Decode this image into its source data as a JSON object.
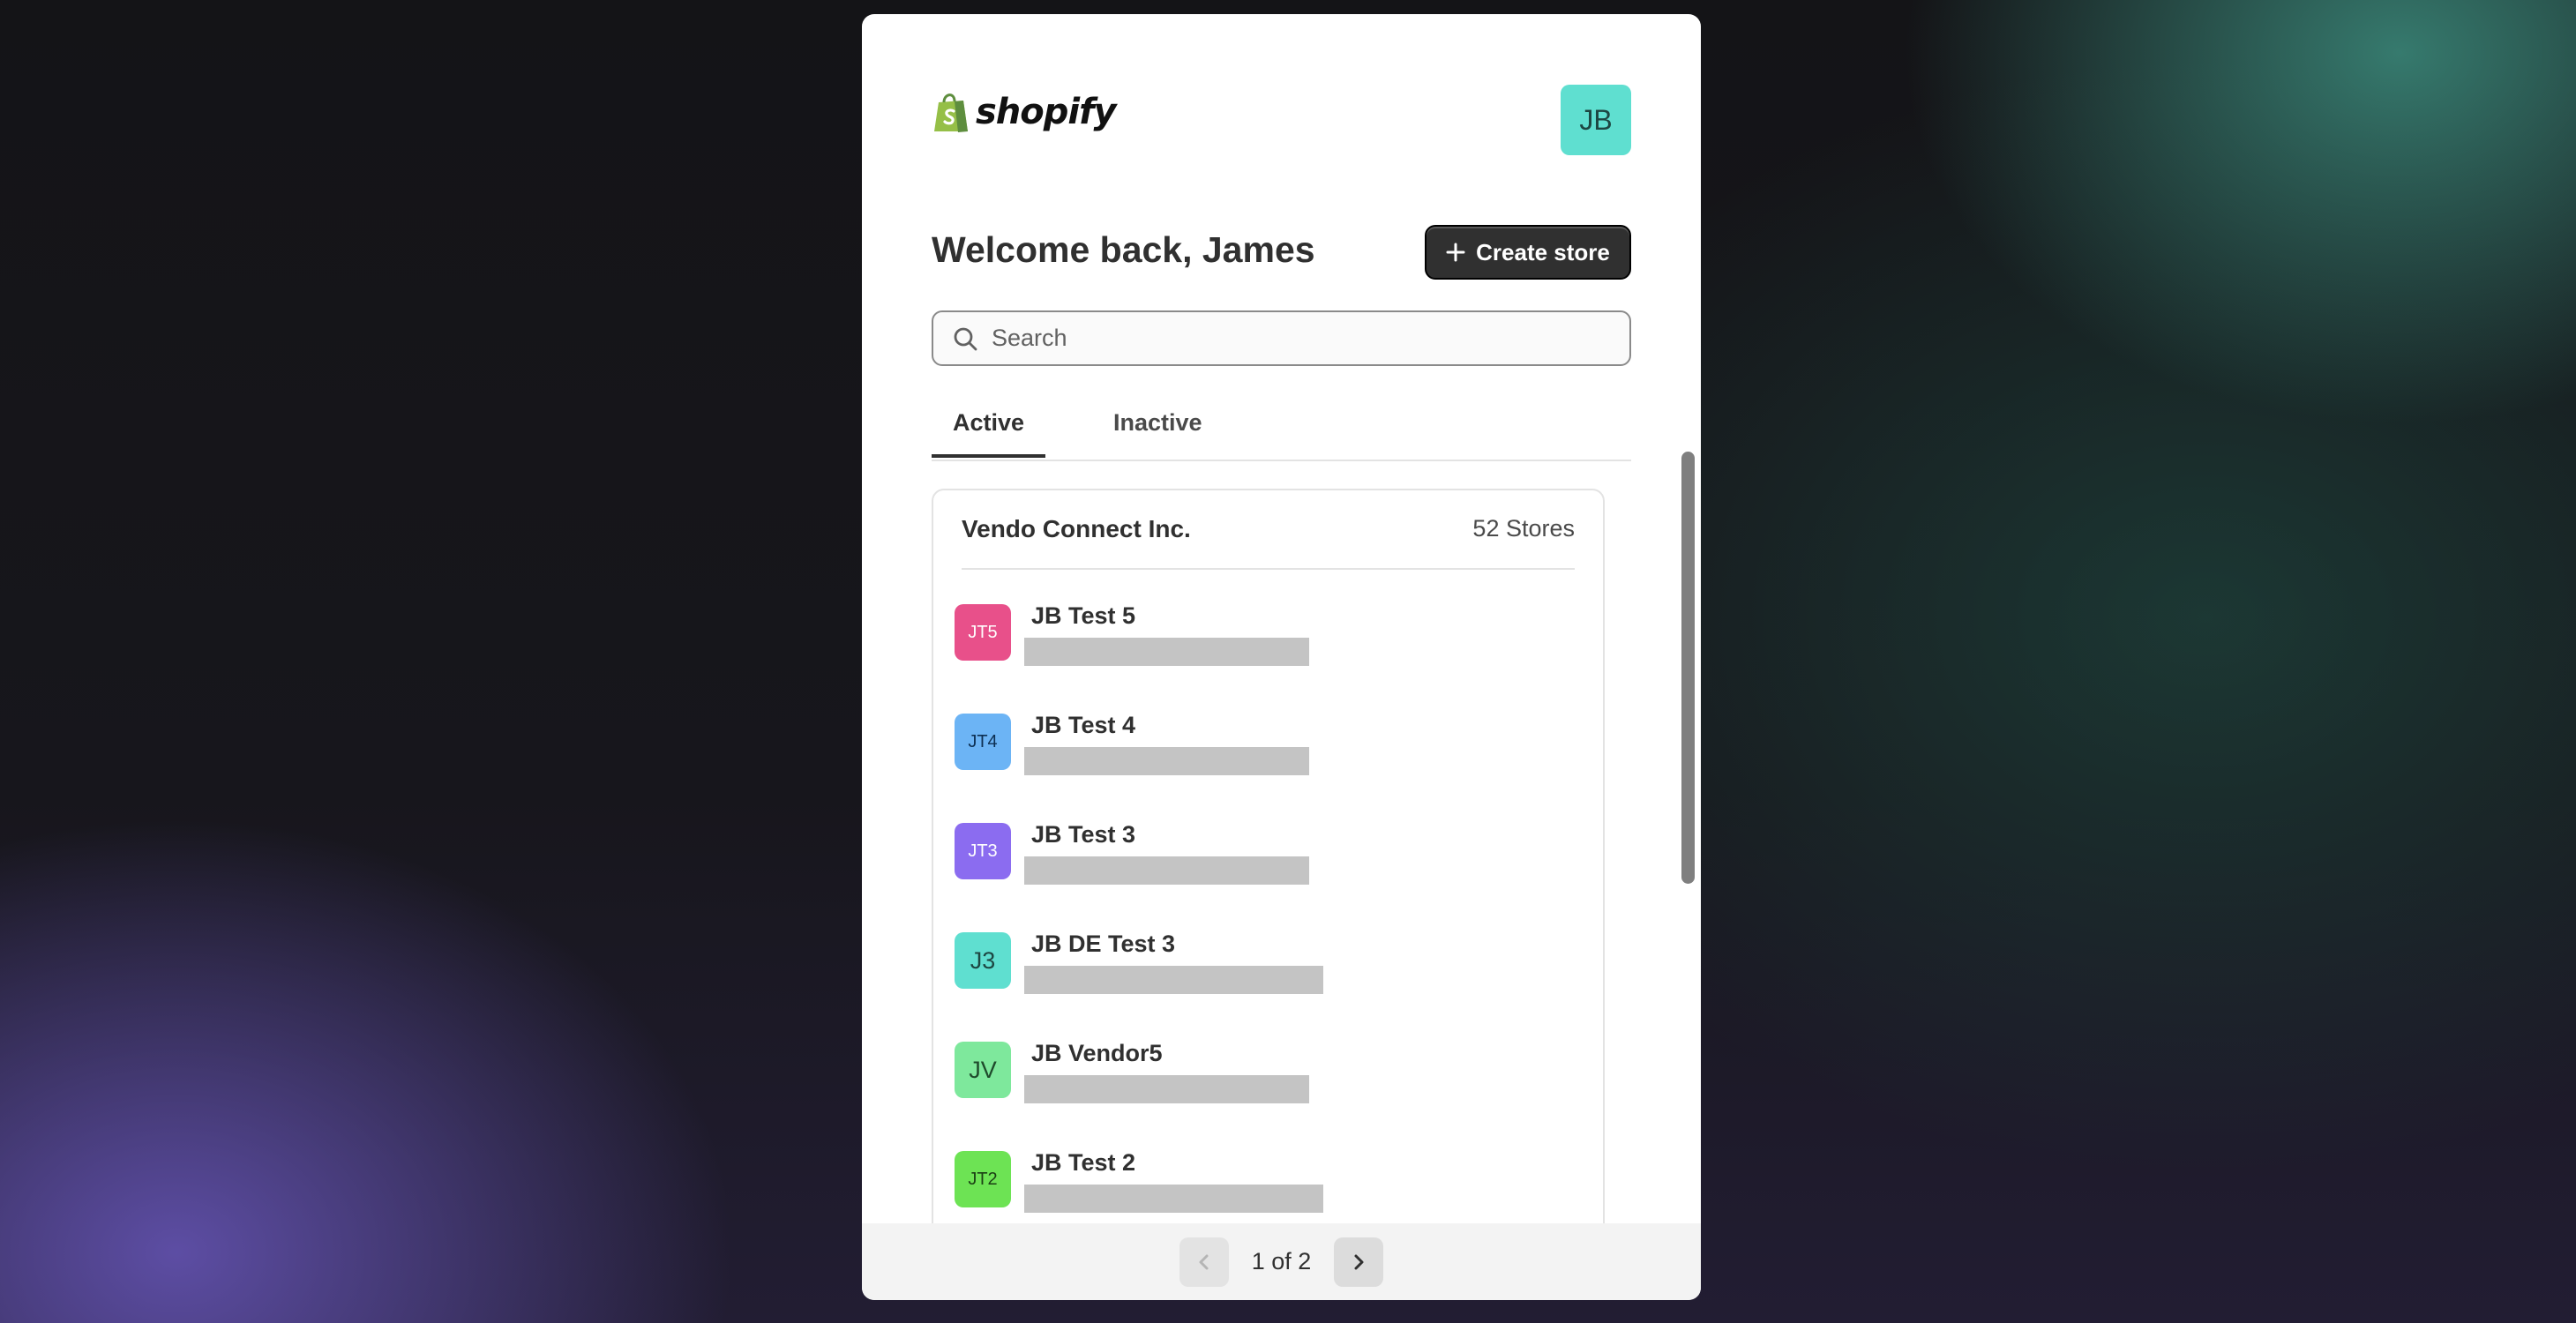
{
  "header": {
    "logo_text": "shopify",
    "user_initials": "JB"
  },
  "main": {
    "welcome": "Welcome back, James",
    "create_store_label": "Create store",
    "search": {
      "placeholder": "Search",
      "value": ""
    },
    "tabs": [
      {
        "label": "Active",
        "selected": true
      },
      {
        "label": "Inactive",
        "selected": false
      }
    ],
    "organization": {
      "name": "Vendo Connect Inc.",
      "count_label": "52 Stores",
      "stores": [
        {
          "initials": "JT5",
          "name": "JB Test 5",
          "color": "#e8508a",
          "text_color": "#ffffff"
        },
        {
          "initials": "JT4",
          "name": "JB Test 4",
          "color": "#6cb4f5",
          "text_color": "#0d2f52"
        },
        {
          "initials": "JT3",
          "name": "JB Test 3",
          "color": "#8b6cf0",
          "text_color": "#ffffff"
        },
        {
          "initials": "J3",
          "name": "JB DE Test 3",
          "color": "#5fdfd0",
          "text_color": "#1d4742"
        },
        {
          "initials": "JV",
          "name": "JB Vendor5",
          "color": "#7ee89c",
          "text_color": "#1f4a2c"
        },
        {
          "initials": "JT2",
          "name": "JB Test 2",
          "color": "#6de354",
          "text_color": "#1b3f14"
        }
      ]
    }
  },
  "pagination": {
    "label": "1 of 2"
  },
  "colors": {
    "accent": "#303030",
    "avatar_top": "#5fdfd0"
  }
}
